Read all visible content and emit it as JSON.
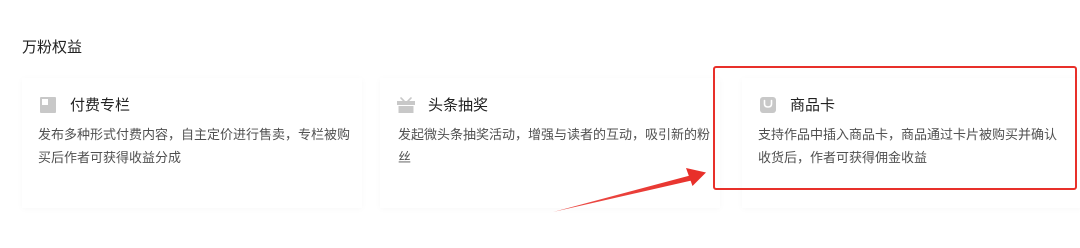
{
  "section": {
    "title": "万粉权益"
  },
  "cards": [
    {
      "title": "付费专栏",
      "description": "发布多种形式付费内容，自主定价进行售卖，专栏被购买后作者可获得收益分成",
      "icon": "column-icon"
    },
    {
      "title": "头条抽奖",
      "description": "发起微头条抽奖活动，增强与读者的互动，吸引新的粉丝",
      "icon": "gift-icon"
    },
    {
      "title": "商品卡",
      "description": "支持作品中插入商品卡，商品通过卡片被购买并确认收货后，作者可获得佣金收益",
      "icon": "shopping-bag-icon"
    }
  ],
  "annotation": {
    "highlight_color": "#e8302a"
  },
  "colors": {
    "icon_gray": "#c8c8c8",
    "text_primary": "#222222",
    "text_secondary": "#505050"
  }
}
